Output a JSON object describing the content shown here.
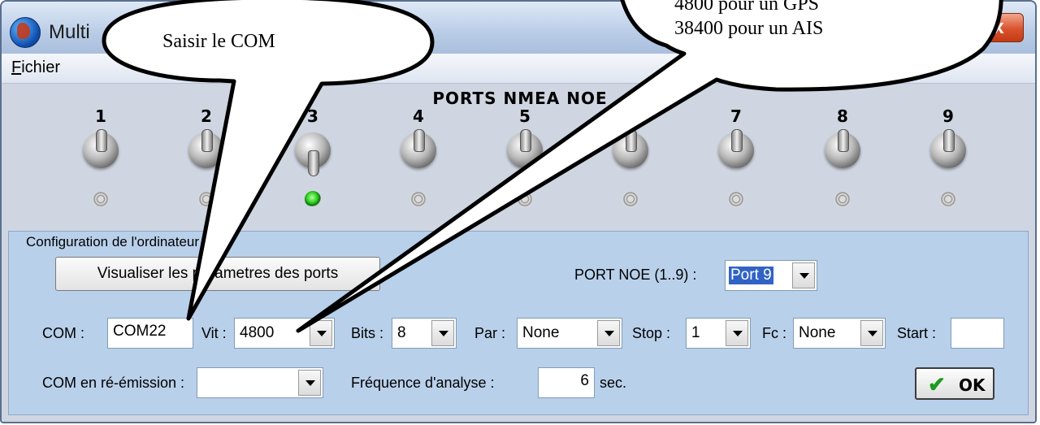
{
  "window": {
    "title": "Multi",
    "close_label": "x"
  },
  "menu": {
    "file_accel": "F",
    "file_rest": "ichier"
  },
  "ports_panel": {
    "title": "PORTS NMEA NOE",
    "ports": [
      {
        "label": "1",
        "active": false
      },
      {
        "label": "2",
        "active": false
      },
      {
        "label": "3",
        "active": true
      },
      {
        "label": "4",
        "active": false
      },
      {
        "label": "5",
        "active": false
      },
      {
        "label": "6",
        "active": false
      },
      {
        "label": "7",
        "active": false
      },
      {
        "label": "8",
        "active": false
      },
      {
        "label": "9",
        "active": false
      }
    ]
  },
  "config": {
    "legend": "Configuration de l'ordinateur",
    "view_params_button": "Visualiser les parametres des ports",
    "port_noe_label": "PORT NOE (1..9) :",
    "port_noe_value": "Port 9",
    "com_label": "COM :",
    "com_value": "COM22",
    "vit_label": "Vit :",
    "vit_value": "4800",
    "bits_label": "Bits :",
    "bits_value": "8",
    "par_label": "Par :",
    "par_value": "None",
    "stop_label": "Stop :",
    "stop_value": "1",
    "fc_label": "Fc :",
    "fc_value": "None",
    "start_label": "Start :",
    "start_value": "",
    "reemit_label": "COM en ré-émission :",
    "reemit_value": "",
    "freq_label": "Fréquence  d'analyse :",
    "freq_value": "6",
    "freq_unit": "sec.",
    "ok_label": "OK"
  },
  "callouts": {
    "left": "Saisir le COM",
    "right_line1": "4800    pour    un    GPS",
    "right_line2": "38400 pour un AIS"
  },
  "colors": {
    "panel": "#b9d0ea",
    "led_on": "#2fcf20",
    "selection": "#3163c5"
  }
}
